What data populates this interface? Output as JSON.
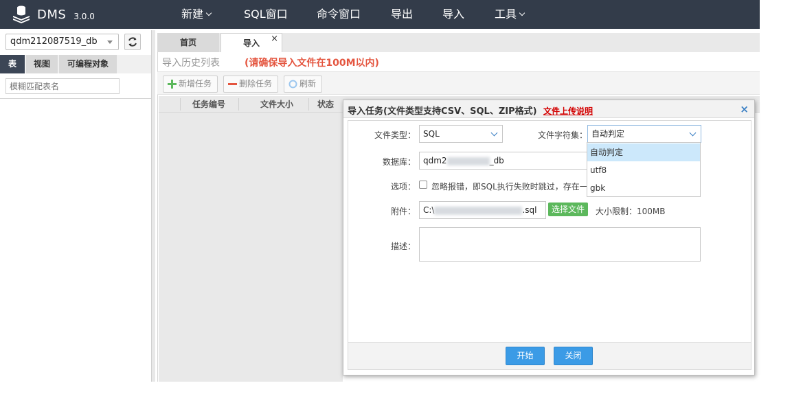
{
  "app": {
    "name": "DMS",
    "version": "3.0.0"
  },
  "menu": {
    "new": "新建",
    "sql_window": "SQL窗口",
    "command_window": "命令窗口",
    "export": "导出",
    "import": "导入",
    "tools": "工具"
  },
  "sidebar": {
    "database": "qdm212087519_db",
    "tabs": [
      "表",
      "视图",
      "可编程对象"
    ],
    "search_placeholder": "模糊匹配表名"
  },
  "main_tabs": {
    "home": "首页",
    "import": "导入",
    "close": "×"
  },
  "history": {
    "title": "导入历史列表",
    "note": "(请确保导入文件在100M以内)"
  },
  "toolbar": {
    "add": "新增任务",
    "delete": "删除任务",
    "refresh": "刷新"
  },
  "grid": {
    "columns": [
      "任务编号",
      "文件大小",
      "状态"
    ]
  },
  "dialog": {
    "title": "导入任务(文件类型支持CSV、SQL、ZIP格式)",
    "help_link": "文件上传说明",
    "close": "×",
    "file_type_label": "文件类型：",
    "file_type_value": "SQL",
    "charset_label": "文件字符集：",
    "charset_value": "自动判定",
    "database_label": "数据库：",
    "database_prefix": "qdm2",
    "database_suffix": "_db",
    "options_label": "选项：",
    "option_text": "忽略报错，即SQL执行失败时跳过，存在一",
    "attachment_label": "附件：",
    "attachment_prefix": "C:\\",
    "attachment_suffix": ".sql",
    "choose_file": "选择文件",
    "size_limit": "大小限制：100MB",
    "description_label": "描述：",
    "start": "开始",
    "close_button": "关闭"
  },
  "charset_options": [
    "自动判定",
    "utf8",
    "gbk"
  ],
  "colors": {
    "topbar": "#333c4a",
    "accent": "#3b9be6",
    "warning": "#e4553f",
    "link": "#d30000",
    "green": "#5cb85c"
  }
}
